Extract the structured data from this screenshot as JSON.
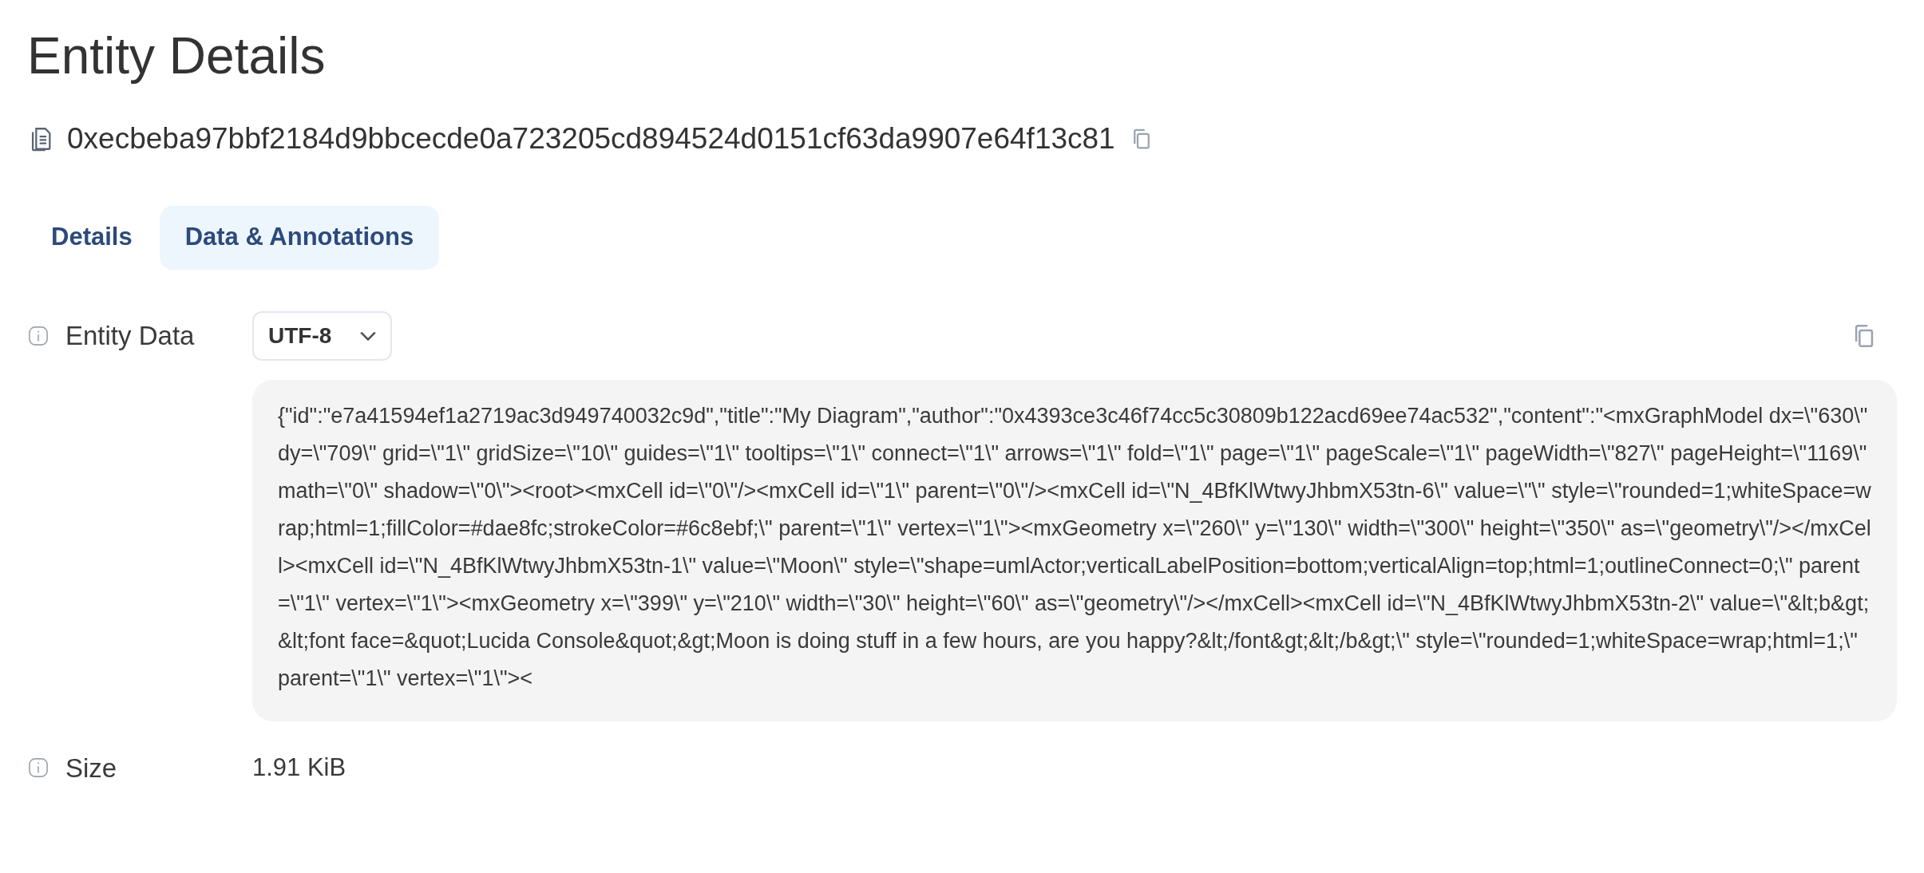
{
  "title": "Entity Details",
  "entity_id": "0xecbeba97bbf2184d9bbcecde0a723205cd894524d0151cf63da9907e64f13c81",
  "tabs": [
    {
      "label": "Details",
      "selected": false
    },
    {
      "label": "Data & Annotations",
      "selected": true
    }
  ],
  "fields": [
    {
      "kind": "data",
      "label": "Entity Data",
      "encoding": "UTF-8",
      "value": "{\"id\":\"e7a41594ef1a2719ac3d949740032c9d\",\"title\":\"My Diagram\",\"author\":\"0x4393ce3c46f74cc5c30809b122acd69ee74ac532\",\"content\":\"<mxGraphModel dx=\\\"630\\\" dy=\\\"709\\\" grid=\\\"1\\\" gridSize=\\\"10\\\" guides=\\\"1\\\" tooltips=\\\"1\\\" connect=\\\"1\\\" arrows=\\\"1\\\" fold=\\\"1\\\" page=\\\"1\\\" pageScale=\\\"1\\\" pageWidth=\\\"827\\\" pageHeight=\\\"1169\\\" math=\\\"0\\\" shadow=\\\"0\\\"><root><mxCell id=\\\"0\\\"/><mxCell id=\\\"1\\\" parent=\\\"0\\\"/><mxCell id=\\\"N_4BfKlWtwyJhbmX53tn-6\\\" value=\\\"\\\" style=\\\"rounded=1;whiteSpace=wrap;html=1;fillColor=#dae8fc;strokeColor=#6c8ebf;\\\" parent=\\\"1\\\" vertex=\\\"1\\\"><mxGeometry x=\\\"260\\\" y=\\\"130\\\" width=\\\"300\\\" height=\\\"350\\\" as=\\\"geometry\\\"/></mxCell><mxCell id=\\\"N_4BfKlWtwyJhbmX53tn-1\\\" value=\\\"Moon\\\" style=\\\"shape=umlActor;verticalLabelPosition=bottom;verticalAlign=top;html=1;outlineConnect=0;\\\" parent=\\\"1\\\" vertex=\\\"1\\\"><mxGeometry x=\\\"399\\\" y=\\\"210\\\" width=\\\"30\\\" height=\\\"60\\\" as=\\\"geometry\\\"/></mxCell><mxCell id=\\\"N_4BfKlWtwyJhbmX53tn-2\\\" value=\\\"&lt;b&gt;&lt;font face=&quot;Lucida Console&quot;&gt;Moon is doing stuff in a few hours, are you happy?&lt;/font&gt;&lt;/b&gt;\\\" style=\\\"rounded=1;whiteSpace=wrap;html=1;\\\" parent=\\\"1\\\" vertex=\\\"1\\\"><"
    },
    {
      "kind": "text",
      "label": "Size",
      "value": "1.91 KiB"
    }
  ]
}
